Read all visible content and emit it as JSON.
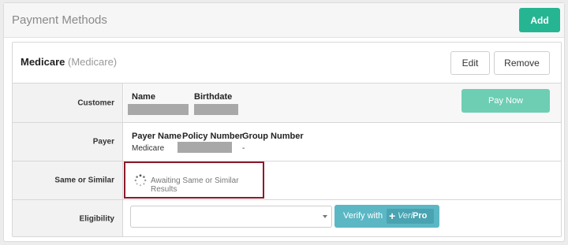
{
  "header": {
    "title": "Payment Methods",
    "add_label": "Add"
  },
  "card": {
    "title": "Medicare",
    "subtitle": "(Medicare)",
    "edit_label": "Edit",
    "remove_label": "Remove"
  },
  "rows": {
    "customer": {
      "label": "Customer",
      "name_header": "Name",
      "birthdate_header": "Birthdate",
      "pay_now_label": "Pay Now"
    },
    "payer": {
      "label": "Payer",
      "payer_name_header": "Payer Name",
      "payer_name_value": "Medicare",
      "policy_number_header": "Policy Number",
      "group_number_header": "Group Number",
      "group_number_value": "-"
    },
    "same_or_similar": {
      "label": "Same or Similar",
      "status_text": "Awaiting Same or Similar Results"
    },
    "eligibility": {
      "label": "Eligibility",
      "select_value": "",
      "verify_label": "Verify with",
      "brand_ver": "Veri",
      "brand_pro": "Pro"
    }
  },
  "colors": {
    "accent_green": "#26b593",
    "pay_now": "#6dceb4",
    "verify": "#5bb7c4",
    "highlight_border": "#8b1a2b"
  },
  "icons": [
    "spinner-icon",
    "chevron-down-icon",
    "plus-icon"
  ]
}
